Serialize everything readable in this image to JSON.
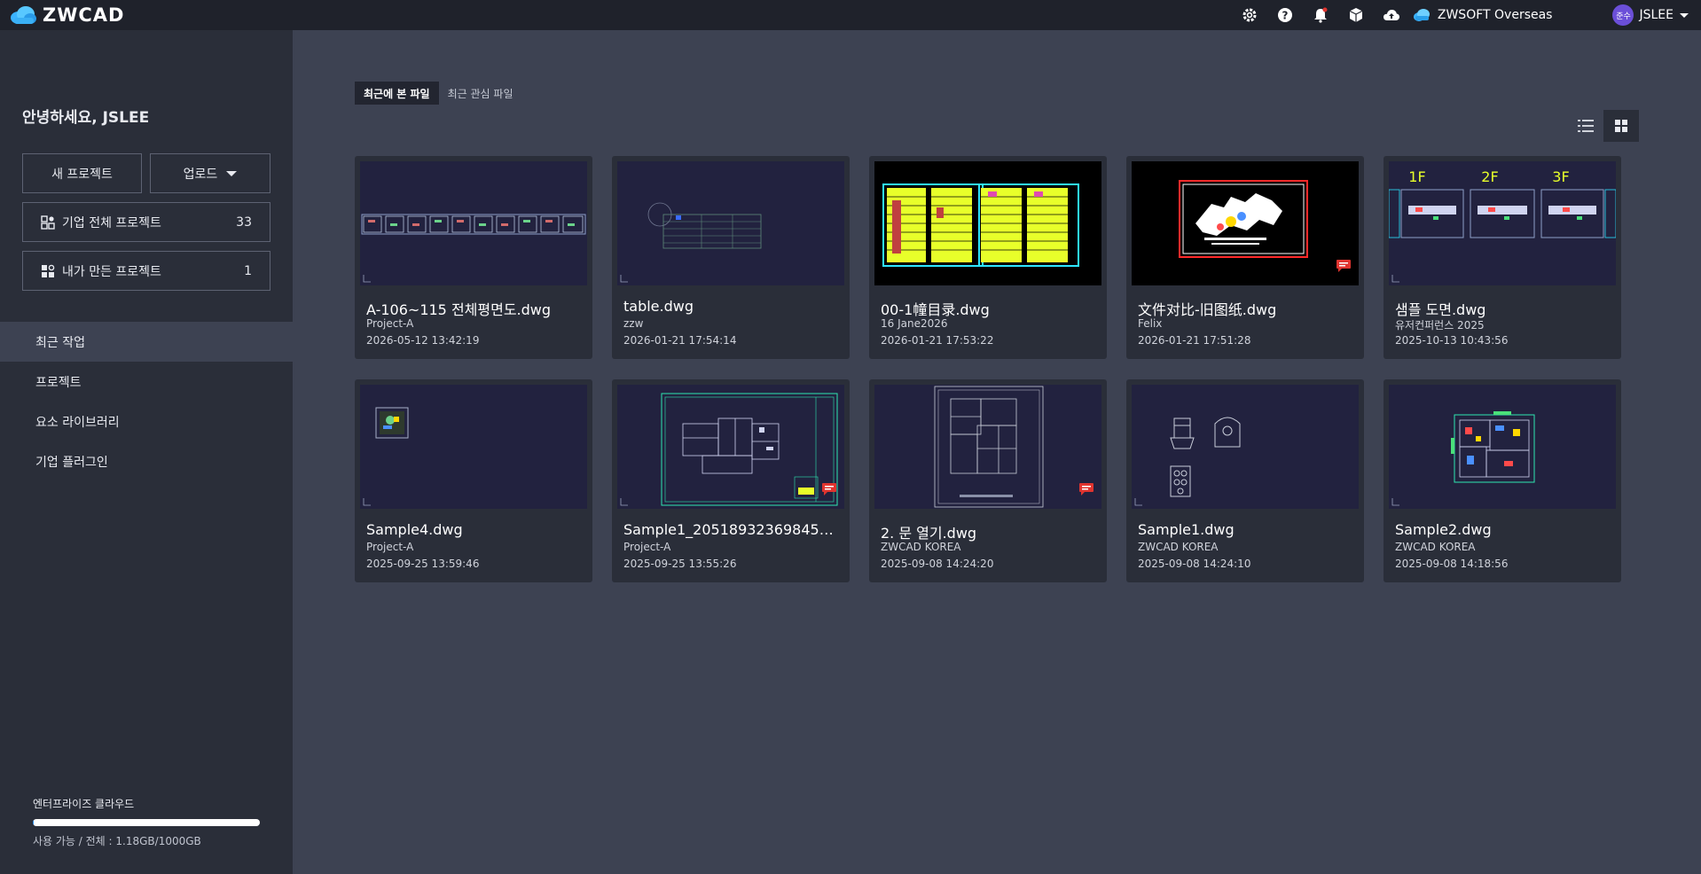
{
  "app": {
    "name": "ZWCAD"
  },
  "topbar": {
    "icons": [
      "gear-icon",
      "help-icon",
      "bell-icon",
      "cube-icon",
      "cloud-upload-icon"
    ],
    "org_name": "ZWSOFT Overseas",
    "avatar_text": "준수",
    "user_name": "JSLEE"
  },
  "sidebar": {
    "greeting": "안녕하세요, JSLEE",
    "new_project_label": "새 프로젝트",
    "upload_label": "업로드",
    "projects": [
      {
        "label": "기업 전체 프로젝트",
        "count": "33"
      },
      {
        "label": "내가 만든 프로젝트",
        "count": "1"
      }
    ],
    "nav": [
      {
        "label": "최근 작업",
        "active": true
      },
      {
        "label": "프로젝트",
        "active": false
      },
      {
        "label": "요소 라이브러리",
        "active": false
      },
      {
        "label": "기업 플러그인",
        "active": false
      }
    ],
    "storage": {
      "title": "엔터프라이즈 클라우드",
      "text": "사용 가능 / 전체 : 1.18GB/1000GB",
      "used_fraction": 0.00118
    }
  },
  "main": {
    "tabs": [
      {
        "label": "최근에 본 파일",
        "active": true
      },
      {
        "label": "최근 관심 파일",
        "active": false
      }
    ],
    "view_modes": [
      "list-view-icon",
      "grid-view-icon"
    ],
    "files": [
      {
        "name": "A-106~115 전체평면도.dwg",
        "project": "Project-A",
        "date": "2026-05-12 13:42:19",
        "thumb": "strip",
        "comment": false
      },
      {
        "name": "table.dwg",
        "project": "zzw",
        "date": "2026-01-21 17:54:14",
        "thumb": "table",
        "comment": false
      },
      {
        "name": "00-1幢目录.dwg",
        "project": "16 Jane2026",
        "date": "2026-01-21 17:53:22",
        "thumb": "yellow",
        "comment": false
      },
      {
        "name": "文件对比-旧图纸.dwg",
        "project": "Felix",
        "date": "2026-01-21 17:51:28",
        "thumb": "compare",
        "comment": true
      },
      {
        "name": "샘플 도면.dwg",
        "project": "유저컨퍼런스 2025",
        "date": "2025-10-13 10:43:56",
        "thumb": "floors",
        "comment": false,
        "floors": [
          "1F",
          "2F",
          "3F"
        ]
      },
      {
        "name": "Sample4.dwg",
        "project": "Project-A",
        "date": "2025-09-25 13:59:46",
        "thumb": "small",
        "comment": false
      },
      {
        "name": "Sample1_2051893236984528...",
        "project": "Project-A",
        "date": "2025-09-25 13:55:26",
        "thumb": "plan",
        "comment": true
      },
      {
        "name": "2. 문 열기.dwg",
        "project": "ZWCAD KOREA",
        "date": "2025-09-08 14:24:20",
        "thumb": "door",
        "comment": true
      },
      {
        "name": "Sample1.dwg",
        "project": "ZWCAD KOREA",
        "date": "2025-09-08 14:24:10",
        "thumb": "parts",
        "comment": false
      },
      {
        "name": "Sample2.dwg",
        "project": "ZWCAD KOREA",
        "date": "2025-09-08 14:18:56",
        "thumb": "colorplan",
        "comment": false
      }
    ]
  },
  "colors": {
    "accent": "#1a8cff",
    "comment_badge": "#e0342f",
    "cad_yellow": "#e8ff2a",
    "cad_cyan": "#2ee6ff"
  }
}
